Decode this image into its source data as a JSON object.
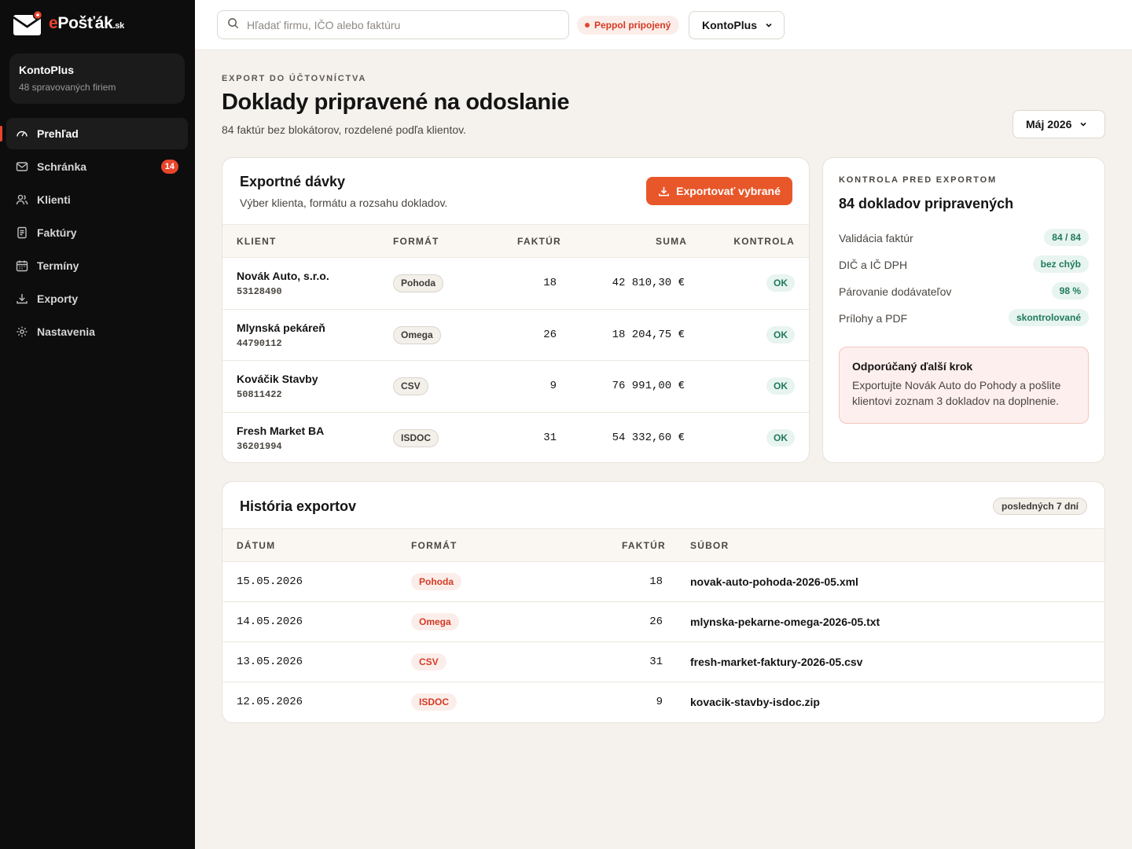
{
  "app": {
    "logo_prefix": "e",
    "logo_main": "Pošťák",
    "logo_suffix": ".sk"
  },
  "colors": {
    "accent": "#e8452c",
    "sidebar_bg": "#0d0d0d",
    "page_bg": "#f5f2ed",
    "ok_green": "#1f7a5c",
    "ok_bg": "#e8f4f0"
  },
  "org_card": {
    "name": "KontoPlus",
    "subtitle": "48 spravovaných firiem"
  },
  "sidebar": {
    "items": [
      {
        "label": "Prehľad",
        "icon": "gauge-icon",
        "active": true
      },
      {
        "label": "Schránka",
        "icon": "inbox-icon",
        "badge": "14"
      },
      {
        "label": "Klienti",
        "icon": "users-icon"
      },
      {
        "label": "Faktúry",
        "icon": "document-icon"
      },
      {
        "label": "Termíny",
        "icon": "calendar-icon"
      },
      {
        "label": "Exporty",
        "icon": "download-icon"
      },
      {
        "label": "Nastavenia",
        "icon": "gear-icon"
      }
    ]
  },
  "topbar": {
    "search_placeholder": "Hľadať firmu, IČO alebo faktúru",
    "peppol_status": "Peppol pripojený",
    "org_selector": "KontoPlus"
  },
  "header": {
    "eyebrow": "EXPORT DO ÚČTOVNÍCTVA",
    "title": "Doklady pripravené na odoslanie",
    "subtitle": "84 faktúr bez blokátorov, rozdelené podľa klientov.",
    "month": "Máj 2026"
  },
  "batches": {
    "title": "Exportné dávky",
    "subtitle": "Výber klienta, formátu a rozsahu dokladov.",
    "export_button": "Exportovať vybrané",
    "columns": [
      "KLIENT",
      "FORMÁT",
      "FAKTÚR",
      "SUMA",
      "KONTROLA"
    ],
    "rows": [
      {
        "name": "Novák Auto, s.r.o.",
        "ico": "53128490",
        "format": "Pohoda",
        "count": "18",
        "sum": "42 810,30 €",
        "status": "OK"
      },
      {
        "name": "Mlynská pekáreň",
        "ico": "44790112",
        "format": "Omega",
        "count": "26",
        "sum": "18 204,75 €",
        "status": "OK"
      },
      {
        "name": "Kováčik Stavby",
        "ico": "50811422",
        "format": "CSV",
        "count": "9",
        "sum": "76 991,00 €",
        "status": "OK"
      },
      {
        "name": "Fresh Market BA",
        "ico": "36201994",
        "format": "ISDOC",
        "count": "31",
        "sum": "54 332,60 €",
        "status": "OK"
      }
    ]
  },
  "check": {
    "eyebrow": "KONTROLA PRED EXPORTOM",
    "title": "84 dokladov pripravených",
    "items": [
      {
        "label": "Validácia faktúr",
        "value": "84 / 84"
      },
      {
        "label": "DIČ a IČ DPH",
        "value": "bez chýb"
      },
      {
        "label": "Párovanie dodávateľov",
        "value": "98 %"
      },
      {
        "label": "Prílohy a PDF",
        "value": "skontrolované"
      }
    ],
    "recommendation_title": "Odporúčaný ďalší krok",
    "recommendation_text": "Exportujte Novák Auto do Pohody a pošlite klientovi zoznam 3 dokladov na doplnenie."
  },
  "history": {
    "title": "História exportov",
    "badge": "posledných 7 dní",
    "columns": [
      "DÁTUM",
      "FORMÁT",
      "FAKTÚR",
      "SÚBOR"
    ],
    "rows": [
      {
        "date": "15.05.2026",
        "format": "Pohoda",
        "count": "18",
        "file": "novak-auto-pohoda-2026-05.xml"
      },
      {
        "date": "14.05.2026",
        "format": "Omega",
        "count": "26",
        "file": "mlynska-pekarne-omega-2026-05.txt"
      },
      {
        "date": "13.05.2026",
        "format": "CSV",
        "count": "31",
        "file": "fresh-market-faktury-2026-05.csv"
      },
      {
        "date": "12.05.2026",
        "format": "ISDOC",
        "count": "9",
        "file": "kovacik-stavby-isdoc.zip"
      }
    ]
  }
}
